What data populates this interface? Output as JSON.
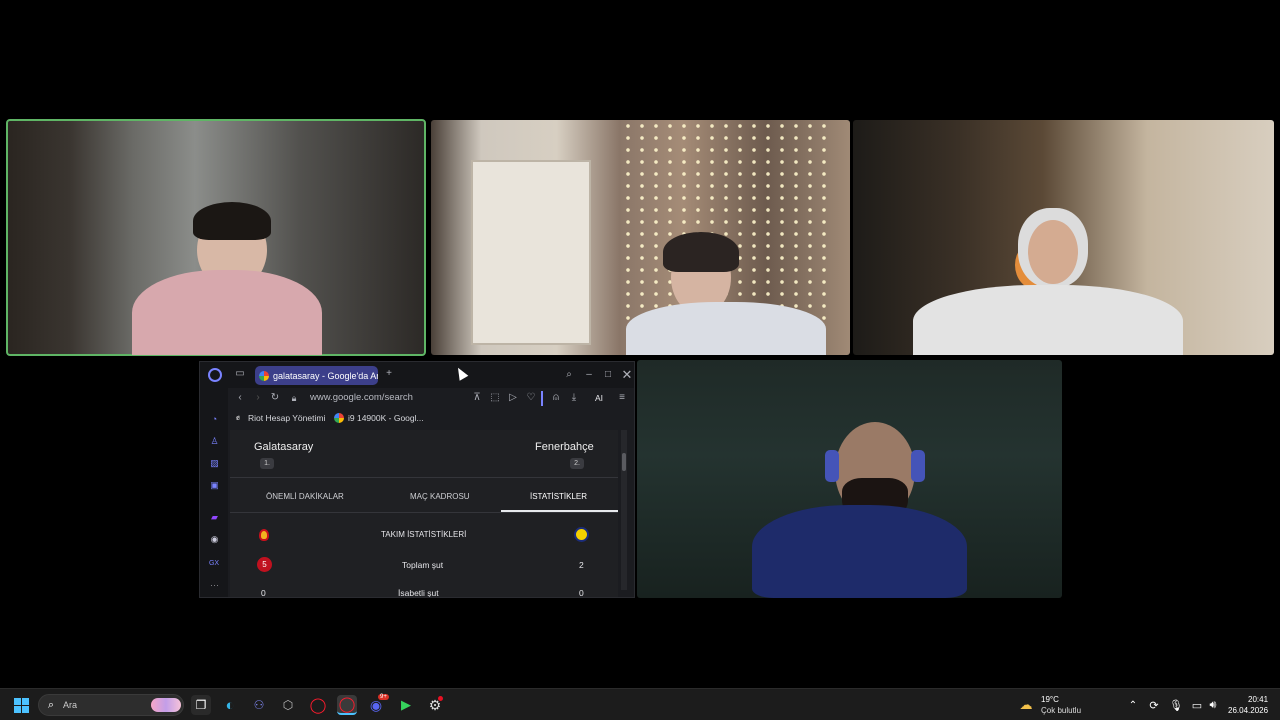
{
  "browser": {
    "tab": {
      "title": "galatasaray - Google'da Ara"
    },
    "new_tab": "+",
    "address": "www.google.com/search",
    "ai_label": "AI",
    "bookmarks": [
      {
        "label": "Riot Hesap Yönetimi"
      },
      {
        "label": "i9 14900K - Googl..."
      }
    ],
    "sidebar_icons": [
      "aria-icon",
      "workspace-icon",
      "wallet-icon",
      "messenger-icon",
      "twitch-icon",
      "discord-icon",
      "gx-icon",
      "more-icon"
    ],
    "sidebar_gx": "GX",
    "sidebar_more": "···",
    "page": {
      "home_team": "Galatasaray",
      "home_rank": "1.",
      "away_team": "Fenerbahçe",
      "away_rank": "2.",
      "tabs": [
        {
          "label": "ÖNEMLİ DAKİKALAR",
          "active": false
        },
        {
          "label": "MAÇ KADROSU",
          "active": false
        },
        {
          "label": "İSTATİSTİKLER",
          "active": true
        }
      ],
      "stats_header": "TAKIM İSTATİSTİKLERİ",
      "stats": [
        {
          "label": "Toplam şut",
          "home": "5",
          "away": "2"
        },
        {
          "label": "İsabetli şut",
          "home": "0",
          "away": "0"
        }
      ]
    }
  },
  "taskbar": {
    "search_label": "Ara",
    "weather_temp": "19°C",
    "weather_desc": "Çok bulutlu",
    "time": "20:41",
    "date": "26.04.2026",
    "discord_badge": "9+"
  },
  "colors": {
    "active_tab": "#3c3f8a",
    "speaking_outline": "#5fb565",
    "opera_accent": "#7a83ff",
    "home_stat_badge": "#c0111f"
  }
}
